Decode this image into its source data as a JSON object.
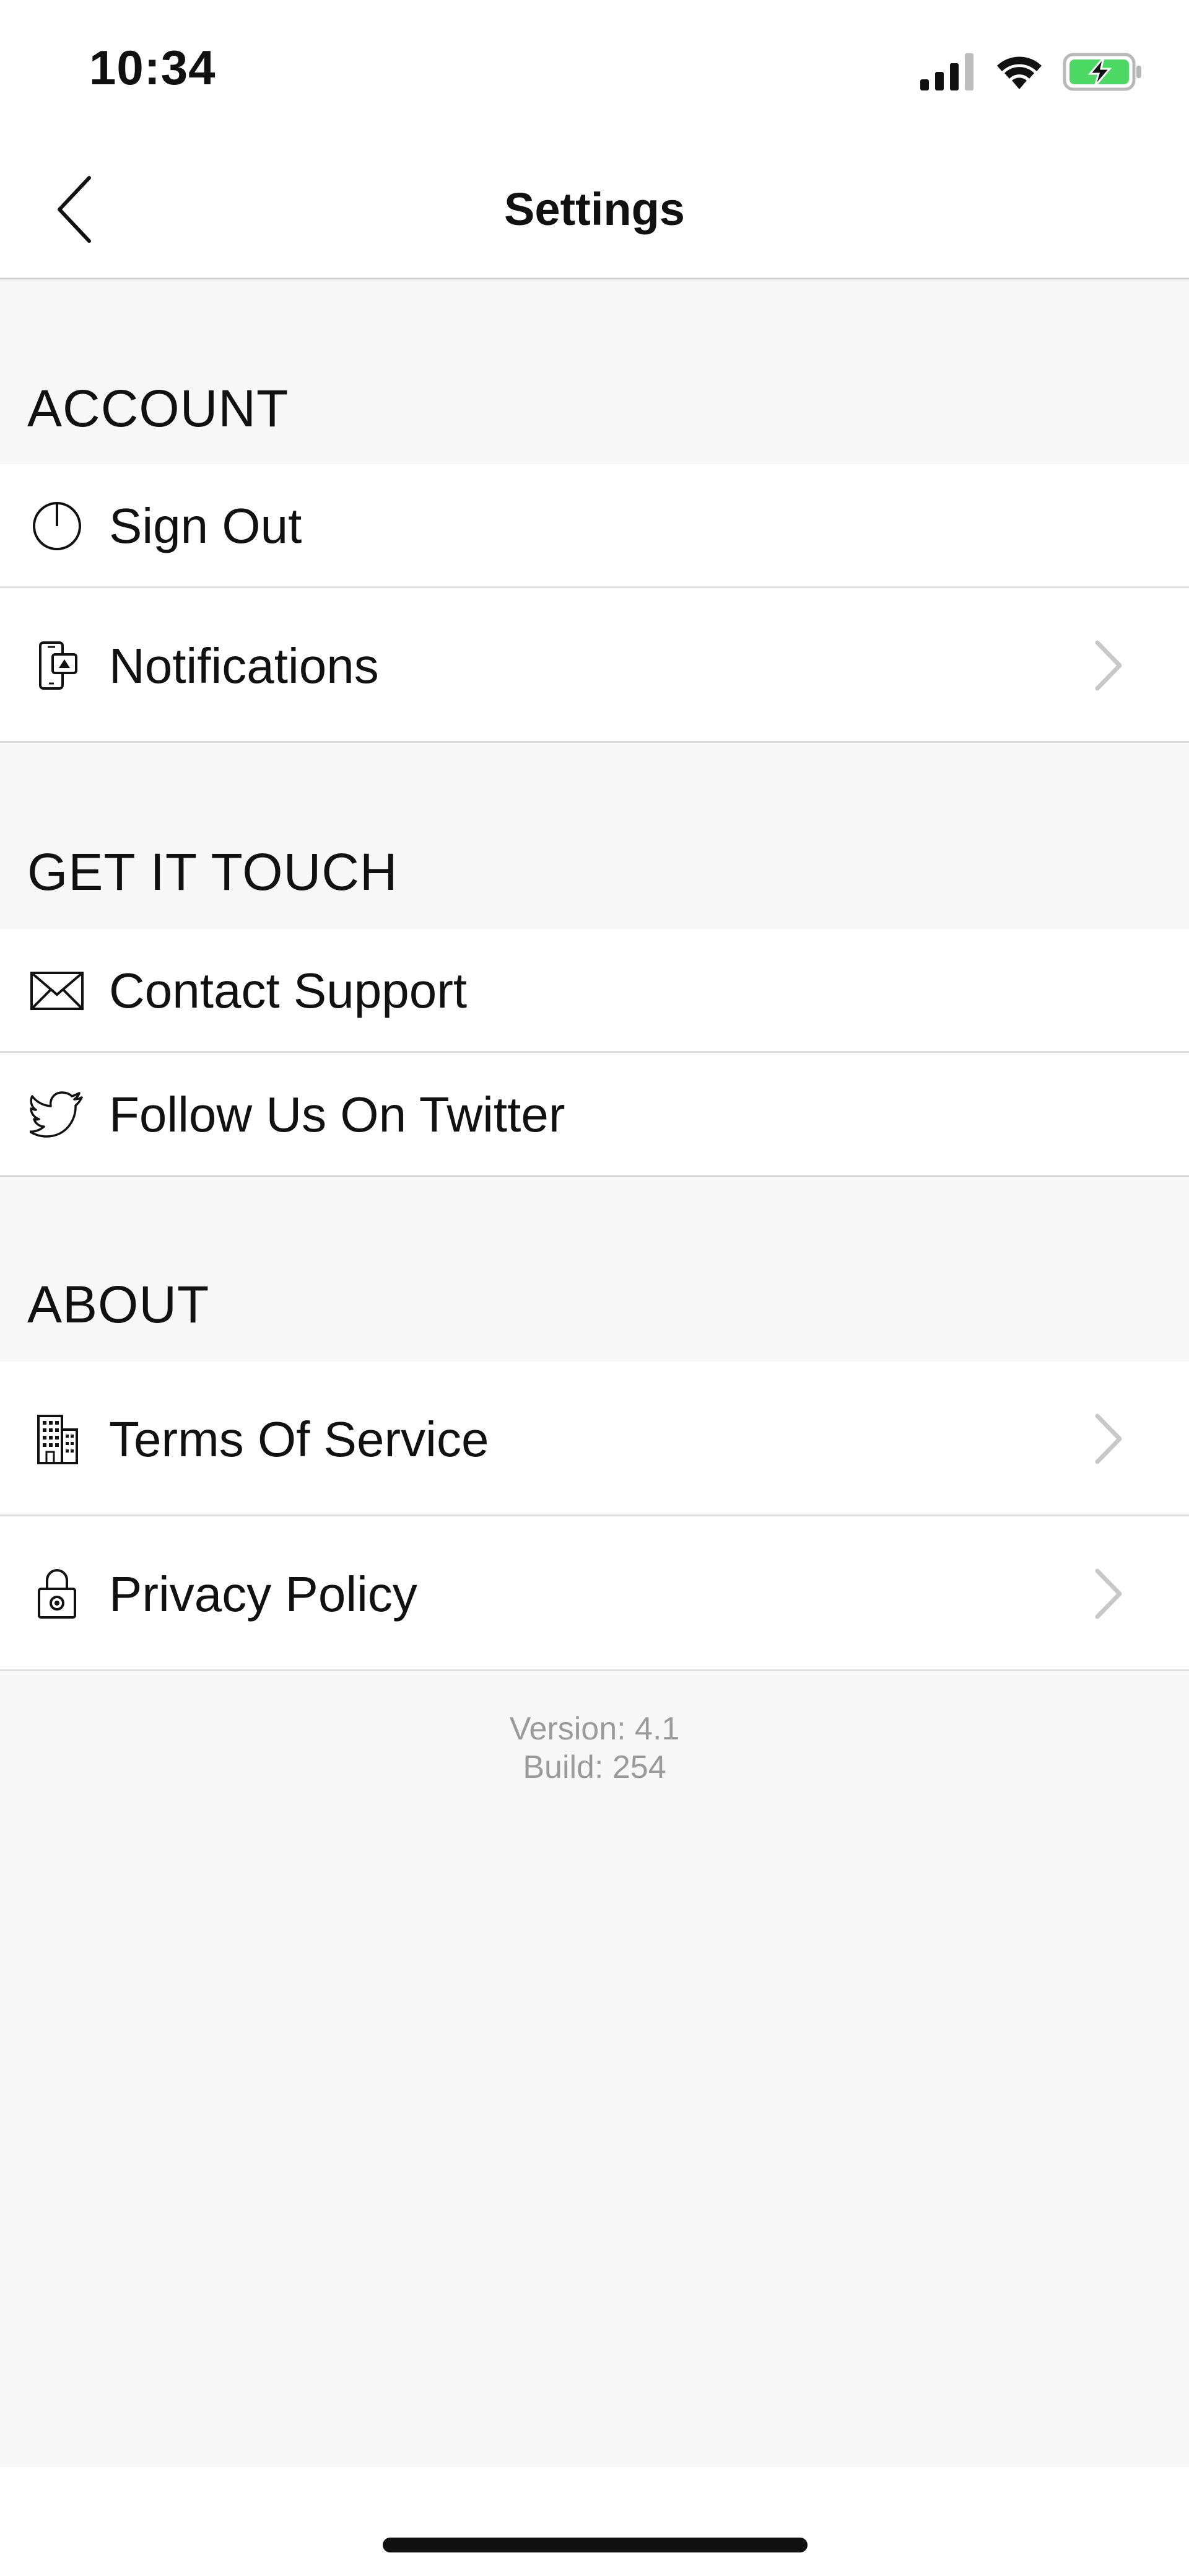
{
  "status_bar": {
    "time": "10:34",
    "icons": [
      "cellular-signal-icon",
      "wifi-icon",
      "battery-charging-icon"
    ],
    "battery_color": "#4cd964"
  },
  "nav": {
    "title": "Settings",
    "back_icon": "chevron-left-icon"
  },
  "sections": {
    "account": {
      "header": "ACCOUNT",
      "items": [
        {
          "label": "Sign Out",
          "icon": "power-icon",
          "chevron": false
        },
        {
          "label": "Notifications",
          "icon": "phone-notification-icon",
          "chevron": true
        }
      ]
    },
    "get_in_touch": {
      "header": "GET IT TOUCH",
      "items": [
        {
          "label": "Contact Support",
          "icon": "envelope-icon",
          "chevron": false
        },
        {
          "label": "Follow Us On Twitter",
          "icon": "twitter-bird-icon",
          "chevron": false
        }
      ]
    },
    "about": {
      "header": "ABOUT",
      "items": [
        {
          "label": "Terms Of Service",
          "icon": "building-icon",
          "chevron": true
        },
        {
          "label": "Privacy Policy",
          "icon": "lock-icon",
          "chevron": true
        }
      ]
    }
  },
  "footer": {
    "version": "Version: 4.1",
    "build": "Build: 254"
  },
  "colors": {
    "background": "#f7f7f7",
    "row_background": "#ffffff",
    "chevron": "#c8c8c8",
    "version_text": "#9a9a9a"
  }
}
